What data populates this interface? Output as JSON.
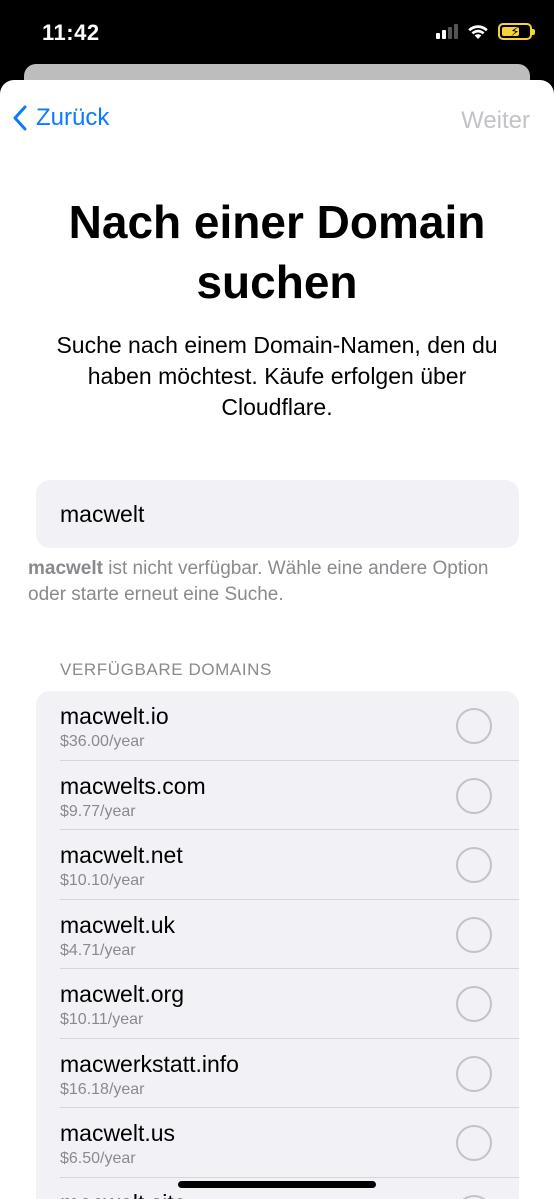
{
  "status_bar": {
    "time": "11:42"
  },
  "nav": {
    "back_label": "Zurück",
    "next_label": "Weiter"
  },
  "title": "Nach einer Domain suchen",
  "subtitle": "Suche nach einem Domain-Namen, den du haben möchtest. Käufe erfolgen über Cloudflare.",
  "search": {
    "value": "macwelt"
  },
  "notice": {
    "term": "macwelt",
    "text": " ist nicht verfügbar. Wähle eine andere Option oder starte erneut eine Suche."
  },
  "section_header": "VERFÜGBARE DOMAINS",
  "domains": [
    {
      "name": "macwelt.io",
      "price": "$36.00/year"
    },
    {
      "name": "macwelts.com",
      "price": "$9.77/year"
    },
    {
      "name": "macwelt.net",
      "price": "$10.10/year"
    },
    {
      "name": "macwelt.uk",
      "price": "$4.71/year"
    },
    {
      "name": "macwelt.org",
      "price": "$10.11/year"
    },
    {
      "name": "macwerkstatt.info",
      "price": "$16.18/year"
    },
    {
      "name": "macwelt.us",
      "price": "$6.50/year"
    },
    {
      "name": "macwelt.site",
      "price": ""
    }
  ],
  "colors": {
    "accent": "#0a7aff",
    "disabled": "#c3c3c7",
    "secondary_text": "#8a8a8e",
    "grouped_bg": "#f1f1f6"
  }
}
